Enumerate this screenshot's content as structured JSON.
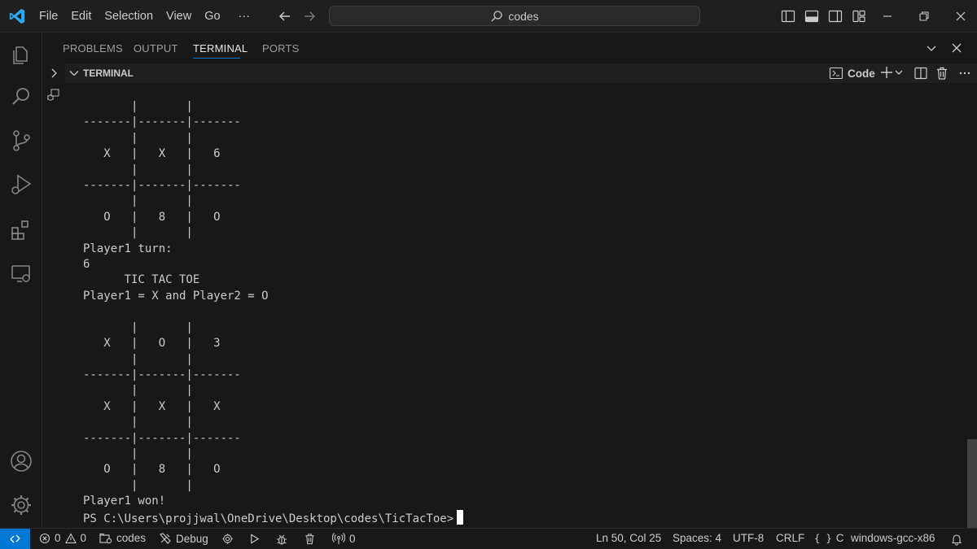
{
  "menu": [
    "File",
    "Edit",
    "Selection",
    "View",
    "Go",
    "···"
  ],
  "search": {
    "text": "codes"
  },
  "panel": {
    "tabs": [
      "PROBLEMS",
      "OUTPUT",
      "TERMINAL",
      "PORTS"
    ],
    "active_tab": "TERMINAL"
  },
  "terminal": {
    "section_title": "TERMINAL",
    "shell_label": "Code",
    "lines": [
      "       |       |",
      "-------|-------|-------",
      "       |       |",
      "   X   |   X   |   6",
      "       |       |",
      "-------|-------|-------",
      "       |       |",
      "   O   |   8   |   O",
      "       |       |",
      "Player1 turn:",
      "6",
      "      TIC TAC TOE",
      "Player1 = X and Player2 = O",
      "",
      "       |       |",
      "   X   |   O   |   3",
      "       |       |",
      "-------|-------|-------",
      "       |       |",
      "   X   |   X   |   X",
      "       |       |",
      "-------|-------|-------",
      "       |       |",
      "   O   |   8   |   O",
      "       |       |",
      "Player1 won!"
    ],
    "prompt": "PS C:\\Users\\projjwal\\OneDrive\\Desktop\\codes\\TicTacToe>"
  },
  "status": {
    "errors": "0",
    "warnings": "0",
    "workspace": "codes",
    "debug": "Debug",
    "ports": "0",
    "position": "Ln 50, Col 25",
    "spaces": "Spaces: 4",
    "encoding": "UTF-8",
    "eol": "CRLF",
    "language": "C",
    "config": "windows-gcc-x86"
  },
  "colors": {
    "accent": "#0078d4",
    "background": "#181818",
    "text": "#cccccc"
  }
}
